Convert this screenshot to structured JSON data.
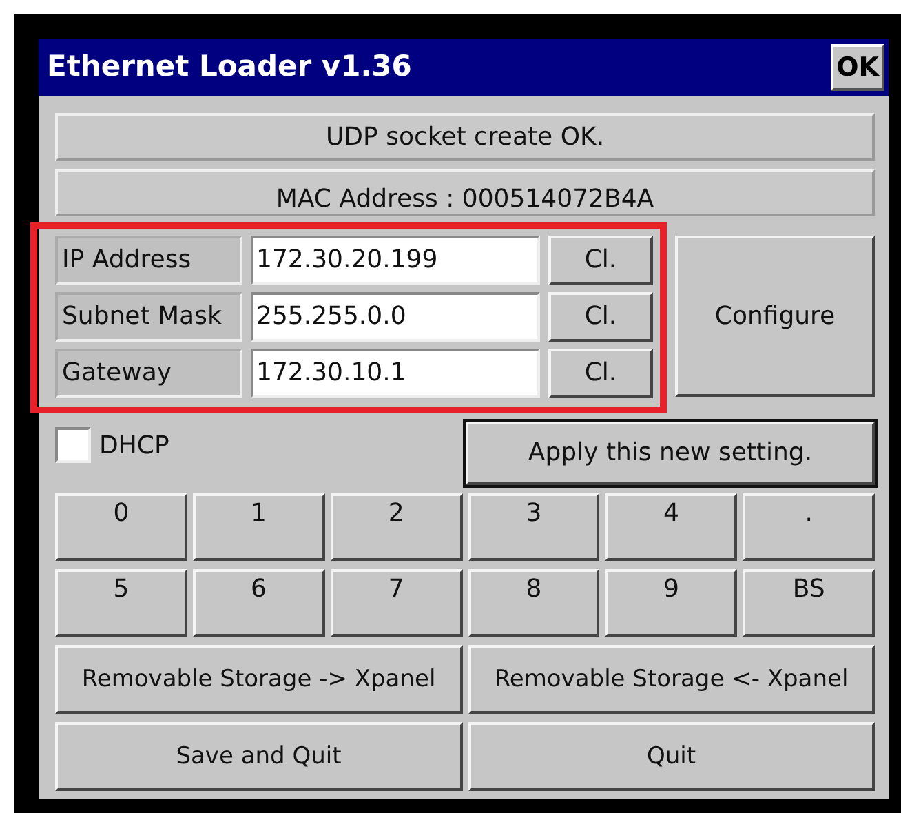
{
  "window": {
    "title": "Ethernet Loader v1.36",
    "ok_button": "OK"
  },
  "status_lines": [
    "UDP socket create OK.",
    "MAC Address : 000514072B4A"
  ],
  "fields": [
    {
      "label": "IP Address",
      "value": "172.30.20.199",
      "clear_button": "Cl."
    },
    {
      "label": "Subnet Mask",
      "value": "255.255.0.0",
      "clear_button": "Cl."
    },
    {
      "label": "Gateway",
      "value": "172.30.10.1",
      "clear_button": "Cl."
    }
  ],
  "configure_button": "Configure",
  "dhcp": {
    "label": "DHCP",
    "checked": false
  },
  "apply_button": {
    "label": "Apply this new setting.",
    "focused": true
  },
  "keypad": [
    "0",
    "1",
    "2",
    "3",
    "4",
    ".",
    "5",
    "6",
    "7",
    "8",
    "9",
    "BS"
  ],
  "storage_buttons": [
    "Removable Storage -> Xpanel",
    "Removable Storage <- Xpanel"
  ],
  "bottom_buttons": [
    "Save and Quit",
    "Quit"
  ],
  "highlight": {
    "color": "#e8202a"
  }
}
